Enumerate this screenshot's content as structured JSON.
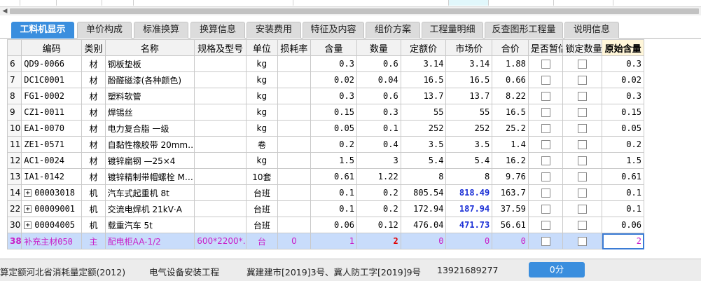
{
  "tabs": [
    {
      "label": "工料机显示",
      "active": true
    },
    {
      "label": "单价构成"
    },
    {
      "label": "标准换算"
    },
    {
      "label": "换算信息"
    },
    {
      "label": "安装费用"
    },
    {
      "label": "特征及内容"
    },
    {
      "label": "组价方案"
    },
    {
      "label": "工程量明细"
    },
    {
      "label": "反查图形工程量"
    },
    {
      "label": "说明信息"
    }
  ],
  "table": {
    "headers": [
      "编码",
      "类别",
      "名称",
      "规格及型号",
      "单位",
      "损耗率",
      "含量",
      "数量",
      "定额价",
      "市场价",
      "合价",
      "是否暂估",
      "锁定数量",
      "原始含量"
    ],
    "rows": [
      {
        "num": "6",
        "code": "QD9-0066",
        "type": "材",
        "name": "钢板垫板",
        "spec": "",
        "unit": "kg",
        "loss": "",
        "content": "0.3",
        "qty": "0.6",
        "quota": "3.14",
        "market": "3.14",
        "total": "1.88",
        "orig": "0.3"
      },
      {
        "num": "7",
        "code": "DC1C0001",
        "type": "材",
        "name": "酚醛磁漆(各种颜色)",
        "spec": "",
        "unit": "kg",
        "loss": "",
        "content": "0.02",
        "qty": "0.04",
        "quota": "16.5",
        "market": "16.5",
        "total": "0.66",
        "orig": "0.02"
      },
      {
        "num": "8",
        "code": "FG1-0002",
        "type": "材",
        "name": "塑料软管",
        "spec": "",
        "unit": "kg",
        "loss": "",
        "content": "0.3",
        "qty": "0.6",
        "quota": "13.7",
        "market": "13.7",
        "total": "8.22",
        "orig": "0.3"
      },
      {
        "num": "9",
        "code": "CZ1-0011",
        "type": "材",
        "name": "焊锡丝",
        "spec": "",
        "unit": "kg",
        "loss": "",
        "content": "0.15",
        "qty": "0.3",
        "quota": "55",
        "market": "55",
        "total": "16.5",
        "orig": "0.15"
      },
      {
        "num": "10",
        "code": "EA1-0070",
        "type": "材",
        "name": "电力复合脂 一级",
        "spec": "",
        "unit": "kg",
        "loss": "",
        "content": "0.05",
        "qty": "0.1",
        "quota": "252",
        "market": "252",
        "total": "25.2",
        "orig": "0.05"
      },
      {
        "num": "11",
        "code": "ZE1-0571",
        "type": "材",
        "name": "自黏性橡胶带 20mm…",
        "spec": "",
        "unit": "卷",
        "loss": "",
        "content": "0.2",
        "qty": "0.4",
        "quota": "3.5",
        "market": "3.5",
        "total": "1.4",
        "orig": "0.2"
      },
      {
        "num": "12",
        "code": "AC1-0024",
        "type": "材",
        "name": "镀锌扁钢 —25×4",
        "spec": "",
        "unit": "kg",
        "loss": "",
        "content": "1.5",
        "qty": "3",
        "quota": "5.4",
        "market": "5.4",
        "total": "16.2",
        "orig": "1.5"
      },
      {
        "num": "13",
        "code": "IA1-0142",
        "type": "材",
        "name": "镀锌精制带帽螺栓 M…",
        "spec": "",
        "unit": "10套",
        "loss": "",
        "content": "0.61",
        "qty": "1.22",
        "quota": "8",
        "market": "8",
        "total": "9.76",
        "orig": "0.61"
      },
      {
        "num": "14",
        "code": "00003018",
        "type": "机",
        "name": "汽车式起重机 8t",
        "spec": "",
        "unit": "台班",
        "loss": "",
        "content": "0.1",
        "qty": "0.2",
        "quota": "805.54",
        "market": "818.49",
        "total": "163.7",
        "orig": "0.1",
        "expandable": true,
        "market_bold": true
      },
      {
        "num": "22",
        "code": "00009001",
        "type": "机",
        "name": "交流电焊机 21kV·A",
        "spec": "",
        "unit": "台班",
        "loss": "",
        "content": "0.1",
        "qty": "0.2",
        "quota": "172.94",
        "market": "187.94",
        "total": "37.59",
        "orig": "0.1",
        "expandable": true,
        "market_bold": true
      },
      {
        "num": "30",
        "code": "00004005",
        "type": "机",
        "name": "载重汽车 5t",
        "spec": "",
        "unit": "台班",
        "loss": "",
        "content": "0.06",
        "qty": "0.12",
        "quota": "476.04",
        "market": "471.73",
        "total": "56.61",
        "orig": "0.06",
        "expandable": true,
        "market_bold": true
      },
      {
        "num": "38",
        "code": "补充主材050",
        "type": "主",
        "name": "配电柜AA-1/2",
        "spec": "600*2200*…",
        "unit": "台",
        "loss": "0",
        "content": "1",
        "qty": "2",
        "quota": "0",
        "market": "0",
        "total": "0",
        "orig": "2",
        "selected": true
      }
    ]
  },
  "status": {
    "item1": "算定额河北省消耗量定额(2012)",
    "item2": "电气设备安装工程",
    "item3": "冀建建市[2019]3号、冀人防工字[2019]9号",
    "item4": "13921689277",
    "score": "0分"
  },
  "colors": {
    "tab_active": "#3a8ede",
    "selected_row": "#c8dcfb",
    "magenta_text": "#c81fc8",
    "blue_price": "#1a2fd6"
  }
}
